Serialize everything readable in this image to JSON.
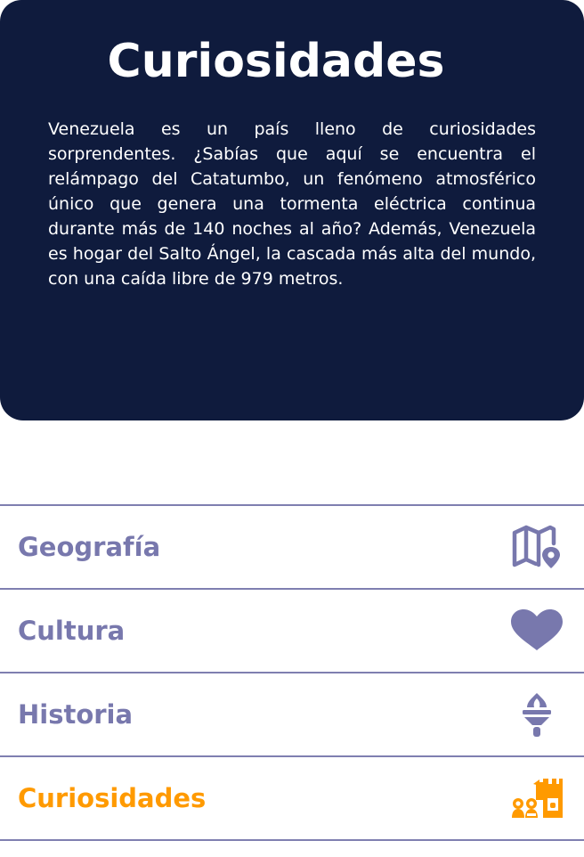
{
  "hero": {
    "title": "Curiosidades",
    "text": "Venezuela es un país lleno de curiosidades sorprendentes. ¿Sabías que aquí se encuentra el relámpago del Catatumbo, un fenómeno atmosférico único que genera una tormenta eléctrica continua durante más de 140 noches al año? Además, Venezuela es hogar del Salto Ángel, la cascada más alta del mundo, con una caída libre de 979 metros."
  },
  "nav": {
    "items": [
      {
        "label": "Geografía",
        "icon": "map-location-icon",
        "active": false
      },
      {
        "label": "Cultura",
        "icon": "heart-icon",
        "active": false
      },
      {
        "label": "Historia",
        "icon": "torch-icon",
        "active": false
      },
      {
        "label": "Curiosidades",
        "icon": "chess-pieces-icon",
        "active": true
      }
    ]
  },
  "colors": {
    "hero_background": "#0f1b3d",
    "nav_text": "#7878ad",
    "active": "#ff9a00",
    "divider": "#7f7fb0"
  }
}
